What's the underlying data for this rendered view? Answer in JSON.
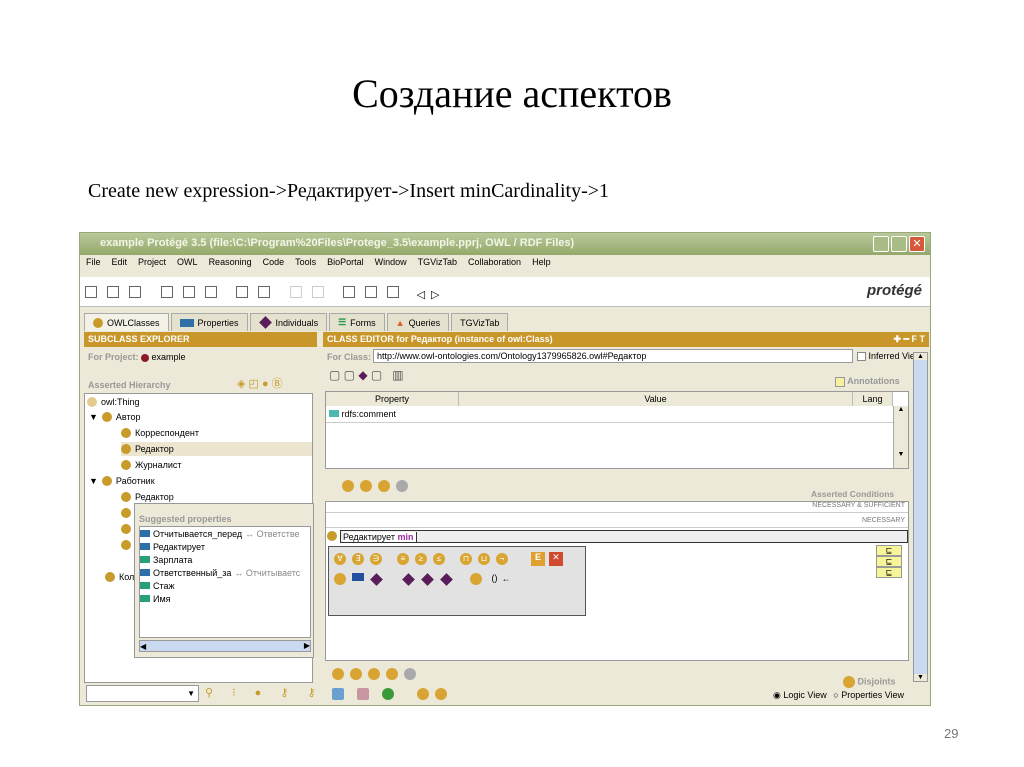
{
  "slide": {
    "title": "Создание аспектов",
    "subtitle": "Create new expression->Редактирует->Insert minCardinality->1",
    "page": "29"
  },
  "window": {
    "title": "example  Protégé 3.5     (file:\\C:\\Program%20Files\\Protege_3.5\\example.pprj, OWL / RDF Files)",
    "logo": "protégé"
  },
  "menu": [
    "File",
    "Edit",
    "Project",
    "OWL",
    "Reasoning",
    "Code",
    "Tools",
    "BioPortal",
    "Window",
    "TGVizTab",
    "Collaboration",
    "Help"
  ],
  "tabs": [
    "OWLClasses",
    "Properties",
    "Individuals",
    "Forms",
    "Queries",
    "TGVizTab"
  ],
  "left": {
    "header": "SUBCLASS EXPLORER",
    "for_project_label": "For Project:",
    "project": "example",
    "hierarchy_label": "Asserted Hierarchy",
    "tree": [
      "owl:Thing",
      "Автор",
      "Корреспондент",
      "Редактор",
      "Журналист",
      "Работник",
      "Редактор",
      "Кол"
    ]
  },
  "suggestions": {
    "title": "Suggested properties",
    "items": [
      {
        "name": "Отчитывается_перед",
        "inverse": "↔ Ответстве",
        "color": "#2e6fa8"
      },
      {
        "name": "Редактирует",
        "inverse": "",
        "color": "#2e6fa8"
      },
      {
        "name": "Зарплата",
        "inverse": "",
        "color": "#2aa07a"
      },
      {
        "name": "Ответственный_за",
        "inverse": "↔ Отчитываетс",
        "color": "#2e6fa8"
      },
      {
        "name": "Стаж",
        "inverse": "",
        "color": "#2aa07a"
      },
      {
        "name": "Имя",
        "inverse": "",
        "color": "#2aa07a"
      }
    ]
  },
  "right": {
    "header": "CLASS EDITOR for Редактор   (instance of owl:Class)",
    "header_icons": "✚ ━ F T",
    "for_class_label": "For Class:",
    "class_uri": "http://www.owl-ontologies.com/Ontology1379965826.owl#Редактор",
    "inferred_view": "Inferred View",
    "annotations": "Annotations",
    "columns": [
      "Property",
      "Value",
      "Lang"
    ],
    "annotation_rows": [
      {
        "property": "rdfs:comment",
        "value": "",
        "lang": ""
      }
    ],
    "asserted_conditions": "Asserted Conditions",
    "nec_suff": "NECESSARY & SUFFICIENT",
    "necessary": "NECESSARY",
    "expression": "Редактирует",
    "keyword": "min",
    "subclass_marks": [
      "⊑",
      "⊑",
      "⊑"
    ],
    "palette_row1": [
      "∀",
      "∃",
      "∋",
      "≡",
      "≥",
      "≤",
      "⊓",
      "⊔",
      "¬"
    ],
    "palette_row2": [
      "()",
      "←"
    ],
    "palette_e": "E",
    "palette_x": "✕",
    "disjoints": "Disjoints",
    "logic_view": "Logic View",
    "properties_view": "Properties View"
  }
}
